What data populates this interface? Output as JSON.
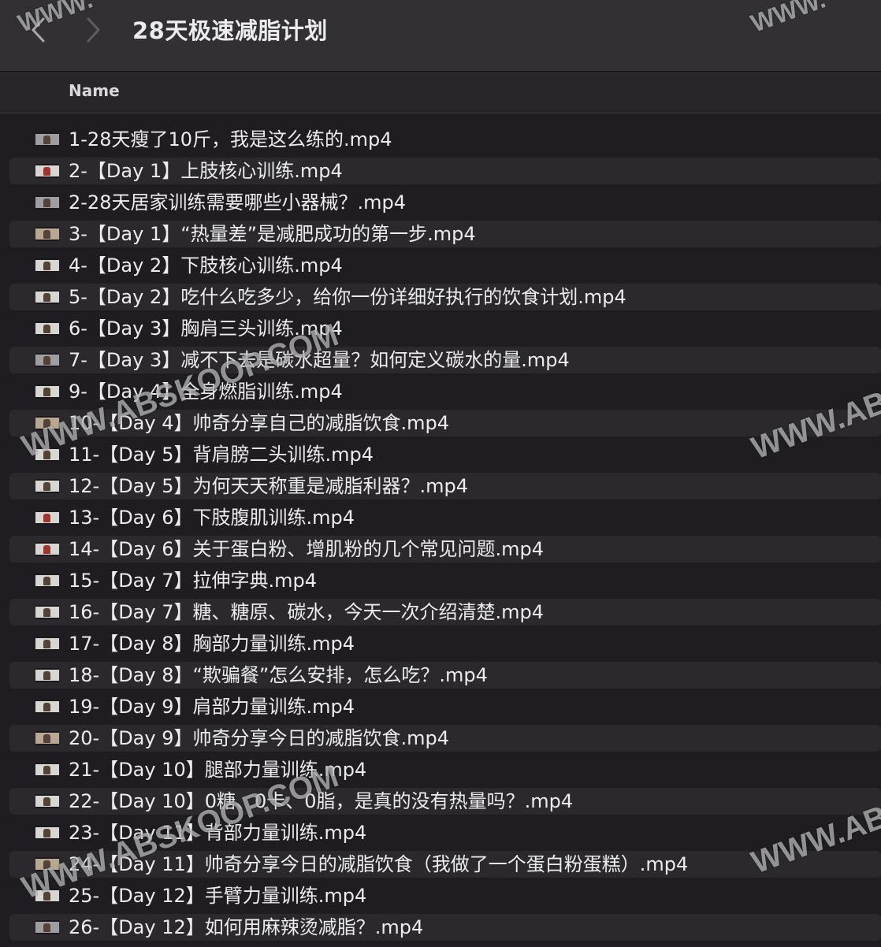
{
  "window": {
    "title": "28天极速减脂计划"
  },
  "columns": {
    "name": "Name"
  },
  "files": [
    {
      "name": "1-28天瘦了10斤，我是这么练的.mp4"
    },
    {
      "name": "2-【Day 1】上肢核心训练.mp4"
    },
    {
      "name": "2-28天居家训练需要哪些小器械？.mp4"
    },
    {
      "name": "3-【Day 1】“热量差”是减肥成功的第一步.mp4"
    },
    {
      "name": "4-【Day 2】下肢核心训练.mp4"
    },
    {
      "name": "5-【Day 2】吃什么吃多少，给你一份详细好执行的饮食计划.mp4"
    },
    {
      "name": "6-【Day 3】胸肩三头训练.mp4"
    },
    {
      "name": "7-【Day 3】减不下去是碳水超量？如何定义碳水的量.mp4"
    },
    {
      "name": "9-【Day 4】全身燃脂训练.mp4"
    },
    {
      "name": "10-【Day 4】帅奇分享自己的减脂饮食.mp4"
    },
    {
      "name": "11-【Day 5】背肩膀二头训练.mp4"
    },
    {
      "name": "12-【Day 5】为何天天称重是减脂利器？.mp4"
    },
    {
      "name": "13-【Day 6】下肢腹肌训练.mp4"
    },
    {
      "name": "14-【Day 6】关于蛋白粉、增肌粉的几个常见问题.mp4"
    },
    {
      "name": "15-【Day 7】拉伸字典.mp4"
    },
    {
      "name": "16-【Day 7】糖、糖原、碳水，今天一次介绍清楚.mp4"
    },
    {
      "name": "17-【Day 8】胸部力量训练.mp4"
    },
    {
      "name": "18-【Day 8】“欺骗餐”怎么安排，怎么吃？.mp4"
    },
    {
      "name": "19-【Day 9】肩部力量训练.mp4"
    },
    {
      "name": "20-【Day 9】帅奇分享今日的减脂饮食.mp4"
    },
    {
      "name": "21-【Day 10】腿部力量训练.mp4"
    },
    {
      "name": "22-【Day 10】0糖、0卡、0脂，是真的没有热量吗？.mp4"
    },
    {
      "name": "23-【Day 11】背部力量训练.mp4"
    },
    {
      "name": "24-【Day 11】帅奇分享今日的减脂饮食（我做了一个蛋白粉蛋糕）.mp4"
    },
    {
      "name": "25-【Day 12】手臂力量训练.mp4"
    },
    {
      "name": "26-【Day 12】如何用麻辣烫减脂？.mp4"
    }
  ],
  "watermark": {
    "text": "WWW.ABSKOOP.COM"
  }
}
